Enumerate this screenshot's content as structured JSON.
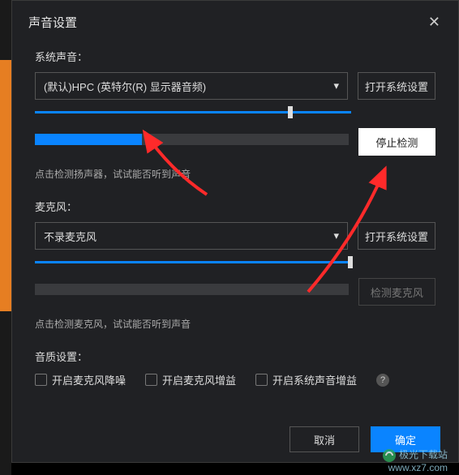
{
  "dialog": {
    "title": "声音设置",
    "close": "✕"
  },
  "system_sound": {
    "label": "系统声音：",
    "selected": "(默认)HPC (英特尔(R) 显示器音频)",
    "open_settings": "打开系统设置",
    "slider_value": 80,
    "progress_value": 34,
    "stop_test": "停止检测",
    "hint": "点击检测扬声器，试试能否听到声音"
  },
  "microphone": {
    "label": "麦克风：",
    "selected": "不录麦克风",
    "open_settings": "打开系统设置",
    "slider_value": 100,
    "progress_value": 0,
    "test": "检测麦克风",
    "hint": "点击检测麦克风，试试能否听到声音"
  },
  "quality": {
    "label": "音质设置：",
    "noise_reduction": "开启麦克风降噪",
    "mic_gain": "开启麦克风增益",
    "system_gain": "开启系统声音增益"
  },
  "footer": {
    "cancel": "取消",
    "confirm": "确定"
  },
  "watermark": {
    "name": "极光下载站",
    "url": "www.xz7.com"
  }
}
